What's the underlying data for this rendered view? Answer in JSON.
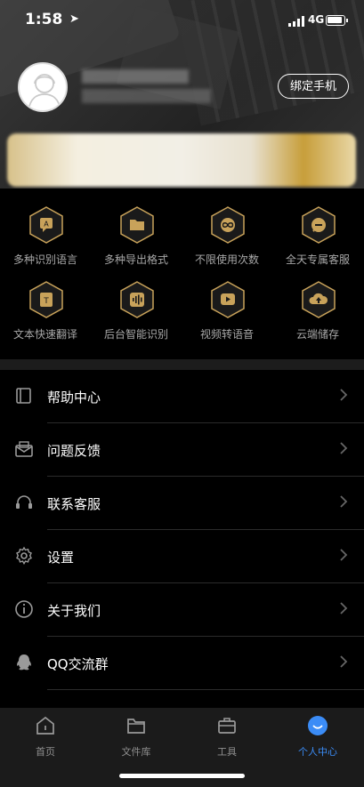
{
  "status_bar": {
    "time": "1:58",
    "network": "4G"
  },
  "profile": {
    "bind_button_label": "绑定手机"
  },
  "features": [
    {
      "label": "多种识别语言",
      "icon": "language-icon"
    },
    {
      "label": "多种导出格式",
      "icon": "folder-icon"
    },
    {
      "label": "不限使用次数",
      "icon": "infinity-icon"
    },
    {
      "label": "全天专属客服",
      "icon": "chat-icon"
    },
    {
      "label": "文本快速翻译",
      "icon": "text-icon"
    },
    {
      "label": "后台智能识别",
      "icon": "waveform-icon"
    },
    {
      "label": "视频转语音",
      "icon": "play-icon"
    },
    {
      "label": "云端储存",
      "icon": "cloud-upload-icon"
    }
  ],
  "menu": [
    {
      "label": "帮助中心",
      "icon": "book-icon"
    },
    {
      "label": "问题反馈",
      "icon": "mail-icon"
    },
    {
      "label": "联系客服",
      "icon": "headset-icon"
    },
    {
      "label": "设置",
      "icon": "gear-icon"
    },
    {
      "label": "关于我们",
      "icon": "info-icon"
    },
    {
      "label": "QQ交流群",
      "icon": "qq-icon"
    }
  ],
  "tabs": [
    {
      "label": "首页",
      "icon": "home-icon",
      "active": false
    },
    {
      "label": "文件库",
      "icon": "folder-icon",
      "active": false
    },
    {
      "label": "工具",
      "icon": "toolbox-icon",
      "active": false
    },
    {
      "label": "个人中心",
      "icon": "profile-icon",
      "active": true
    }
  ],
  "colors": {
    "accent_gold": "#c8a25a",
    "active_tab": "#3b8cf6",
    "background": "#000000"
  }
}
